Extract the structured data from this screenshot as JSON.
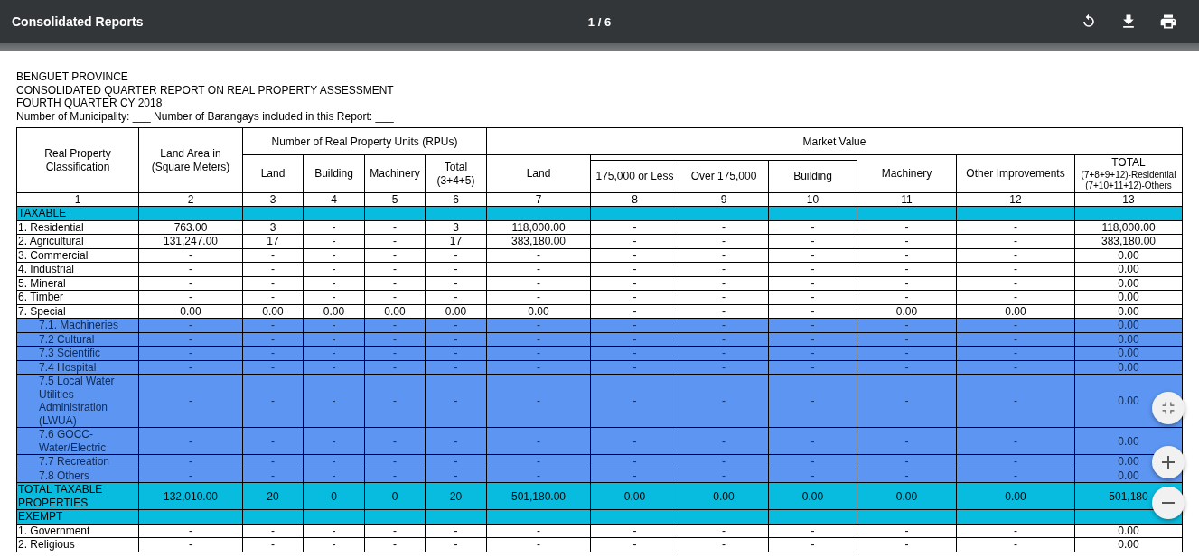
{
  "toolbar": {
    "title": "Consolidated Reports",
    "page_indicator": "1 / 6"
  },
  "report": {
    "heading_lines": [
      "BENGUET PROVINCE",
      "CONSOLIDATED QUARTER REPORT ON REAL PROPERTY ASSESSMENT",
      "FOURTH QUARTER CY 2018",
      "Number of Municipality: ___ Number of Barangays included in this Report: ___"
    ],
    "table": {
      "columns": [
        {
          "label": "Real Property Classification"
        },
        {
          "label": "Land Area in (Square Meters)"
        },
        {
          "label": "Number of Real Property Units (RPUs)",
          "children": [
            {
              "label": "Land"
            },
            {
              "label": "Building"
            },
            {
              "label": "Machinery"
            },
            {
              "label": "Total (3+4+5)"
            }
          ]
        },
        {
          "label": "Market Value",
          "children": [
            {
              "label": "Land"
            },
            {
              "children": [
                {
                  "label": "175,000 or Less"
                },
                {
                  "label": "Over 175,000"
                },
                {
                  "label": "Building"
                }
              ]
            },
            {
              "label": "Machinery"
            },
            {
              "label": "Other Improvements"
            },
            {
              "label": "TOTAL",
              "notes": [
                "(7+8+9+12)-Residential",
                "(7+10+11+12)-Others"
              ]
            }
          ]
        }
      ],
      "column_numbers": [
        "1",
        "2",
        "3",
        "4",
        "5",
        "6",
        "7",
        "8",
        "9",
        "10",
        "11",
        "12",
        "13"
      ],
      "rows": [
        {
          "kind": "section",
          "label": "TAXABLE"
        },
        {
          "kind": "item",
          "label": "1. Residential",
          "cells": [
            "763.00",
            "3",
            "-",
            "-",
            "3",
            "118,000.00",
            "-",
            "-",
            "-",
            "-",
            "-",
            "118,000.00"
          ]
        },
        {
          "kind": "item",
          "label": "2. Agricultural",
          "cells": [
            "131,247.00",
            "17",
            "-",
            "-",
            "17",
            "383,180.00",
            "-",
            "-",
            "-",
            "-",
            "-",
            "383,180.00"
          ]
        },
        {
          "kind": "item",
          "label": "3. Commercial",
          "cells": [
            "-",
            "-",
            "-",
            "-",
            "-",
            "-",
            "-",
            "-",
            "-",
            "-",
            "-",
            "0.00"
          ]
        },
        {
          "kind": "item",
          "label": "4. Industrial",
          "cells": [
            "-",
            "-",
            "-",
            "-",
            "-",
            "-",
            "-",
            "-",
            "-",
            "-",
            "-",
            "0.00"
          ]
        },
        {
          "kind": "item",
          "label": "5. Mineral",
          "cells": [
            "-",
            "-",
            "-",
            "-",
            "-",
            "-",
            "-",
            "-",
            "-",
            "-",
            "-",
            "0.00"
          ]
        },
        {
          "kind": "item",
          "label": "6. Timber",
          "cells": [
            "-",
            "-",
            "-",
            "-",
            "-",
            "-",
            "-",
            "-",
            "-",
            "-",
            "-",
            "0.00"
          ]
        },
        {
          "kind": "item",
          "label": "7. Special",
          "cells": [
            "0.00",
            "0.00",
            "0.00",
            "0.00",
            "0.00",
            "0.00",
            "-",
            "-",
            "-",
            "0.00",
            "0.00",
            "0.00"
          ]
        },
        {
          "kind": "sub",
          "label": "7.1. Machineries",
          "cells": [
            "-",
            "-",
            "-",
            "-",
            "-",
            "-",
            "-",
            "-",
            "-",
            "-",
            "-",
            "0.00"
          ]
        },
        {
          "kind": "sub",
          "label": "7.2 Cultural",
          "cells": [
            "-",
            "-",
            "-",
            "-",
            "-",
            "-",
            "-",
            "-",
            "-",
            "-",
            "-",
            "0.00"
          ]
        },
        {
          "kind": "sub",
          "label": "7.3 Scientific",
          "cells": [
            "-",
            "-",
            "-",
            "-",
            "-",
            "-",
            "-",
            "-",
            "-",
            "-",
            "-",
            "0.00"
          ]
        },
        {
          "kind": "sub",
          "label": "7.4 Hospital",
          "cells": [
            "-",
            "-",
            "-",
            "-",
            "-",
            "-",
            "-",
            "-",
            "-",
            "-",
            "-",
            "0.00"
          ]
        },
        {
          "kind": "sub",
          "label": "7.5 Local Water Utilities Administration (LWUA)",
          "cells": [
            "-",
            "-",
            "-",
            "-",
            "-",
            "-",
            "-",
            "-",
            "-",
            "-",
            "-",
            "0.00"
          ]
        },
        {
          "kind": "sub",
          "label": "7.6 GOCC-Water/Electric",
          "cells": [
            "-",
            "-",
            "-",
            "-",
            "-",
            "-",
            "-",
            "-",
            "-",
            "-",
            "-",
            "0.00"
          ]
        },
        {
          "kind": "sub",
          "label": "7.7 Recreation",
          "cells": [
            "-",
            "-",
            "-",
            "-",
            "-",
            "-",
            "-",
            "-",
            "-",
            "-",
            "-",
            "0.00"
          ]
        },
        {
          "kind": "sub",
          "label": "7.8 Others",
          "cells": [
            "-",
            "-",
            "-",
            "-",
            "-",
            "-",
            "-",
            "-",
            "-",
            "-",
            "-",
            "0.00"
          ]
        },
        {
          "kind": "total",
          "label": "TOTAL TAXABLE PROPERTIES",
          "cells": [
            "132,010.00",
            "20",
            "0",
            "0",
            "20",
            "501,180.00",
            "0.00",
            "0.00",
            "0.00",
            "0.00",
            "0.00",
            "501,180"
          ]
        },
        {
          "kind": "section",
          "label": "EXEMPT"
        },
        {
          "kind": "item",
          "label": "1. Government",
          "cells": [
            "-",
            "-",
            "-",
            "-",
            "-",
            "-",
            "-",
            "-",
            "-",
            "-",
            "-",
            "0.00"
          ]
        },
        {
          "kind": "item",
          "label": "2. Religious",
          "cells": [
            "-",
            "-",
            "-",
            "-",
            "-",
            "-",
            "-",
            "-",
            "-",
            "-",
            "-",
            "0.00"
          ]
        }
      ]
    }
  }
}
